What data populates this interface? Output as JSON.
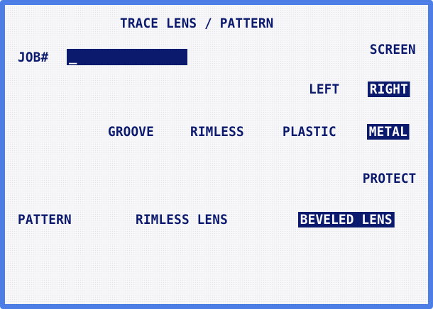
{
  "screen_title": "TRACE LENS / PATTERN",
  "job": {
    "label": "JOB#",
    "value": "_"
  },
  "screen_label": "SCREEN",
  "side": {
    "options": [
      "LEFT",
      "RIGHT"
    ],
    "selected": "RIGHT"
  },
  "frame_type": {
    "options": [
      "GROOVE",
      "RIMLESS",
      "PLASTIC",
      "METAL"
    ],
    "selected": "METAL"
  },
  "protect_label": "PROTECT",
  "pattern": {
    "label": "PATTERN",
    "options": [
      "RIMLESS LENS",
      "BEVELED LENS"
    ],
    "selected": "BEVELED LENS"
  },
  "colors": {
    "text": "#0c1a6e",
    "selection_bg": "#0c1a6e",
    "selection_text": "#ffffff",
    "frame": "#4d7ee6"
  }
}
